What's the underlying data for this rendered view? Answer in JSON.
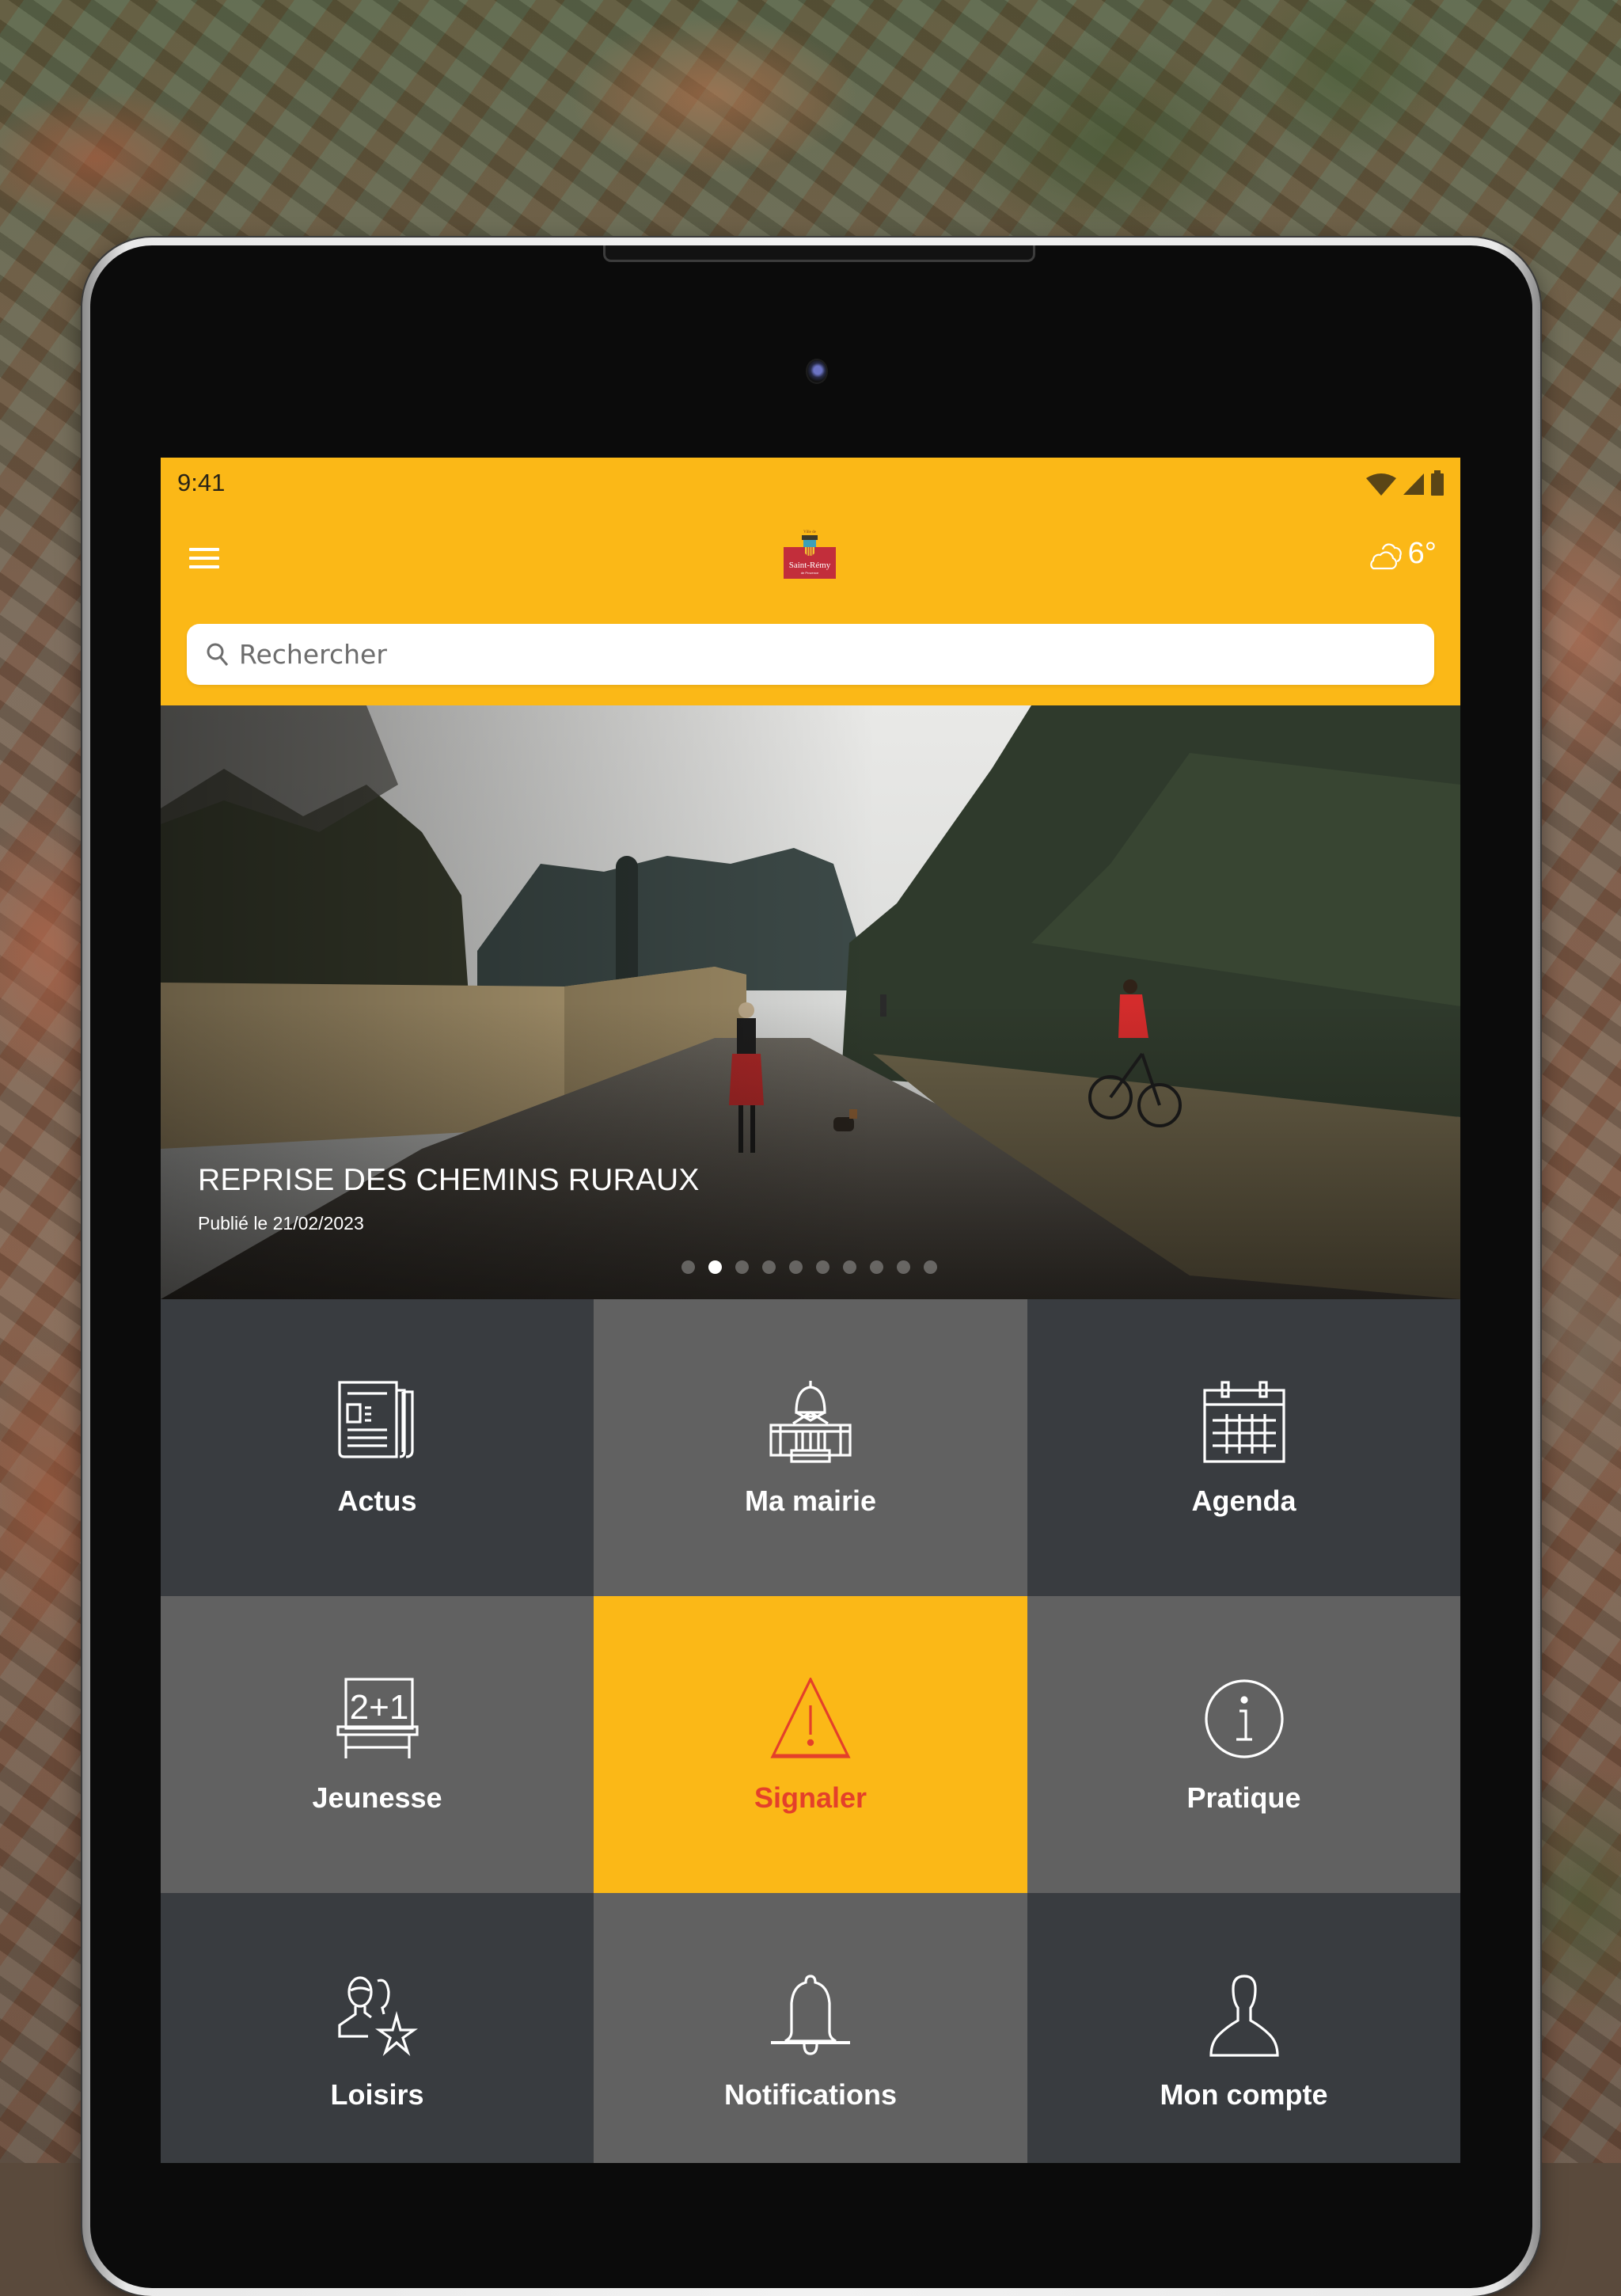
{
  "status_bar": {
    "time": "9:41",
    "icons": [
      "wifi-icon",
      "signal-icon",
      "battery-icon"
    ]
  },
  "app_bar": {
    "menu_icon": "hamburger-menu-icon",
    "logo": {
      "top_text": "Ville de",
      "name": "Saint-Rémy",
      "sub_text": "de Provence"
    },
    "weather": {
      "icon": "cloudy-icon",
      "temperature": "6°"
    }
  },
  "search": {
    "icon": "search-icon",
    "placeholder": "Rechercher",
    "value": ""
  },
  "hero": {
    "title": "REPRISE DES CHEMINS RURAUX",
    "date": "Publié le 21/02/2023",
    "slide_count": 10,
    "active_slide": 2
  },
  "tiles": [
    {
      "label": "Actus",
      "icon": "newspaper-icon"
    },
    {
      "label": "Ma mairie",
      "icon": "town-hall-icon"
    },
    {
      "label": "Agenda",
      "icon": "calendar-icon"
    },
    {
      "label": "Jeunesse",
      "icon": "chalkboard-icon"
    },
    {
      "label": "Signaler",
      "icon": "warning-icon"
    },
    {
      "label": "Pratique",
      "icon": "info-icon"
    },
    {
      "label": "Loisirs",
      "icon": "people-star-icon"
    },
    {
      "label": "Notifications",
      "icon": "bell-icon"
    },
    {
      "label": "Mon compte",
      "icon": "user-icon"
    }
  ],
  "colors": {
    "brand_yellow": "#fbb817",
    "signal_red": "#e4402a",
    "tile_dark": "#393c40",
    "tile_mid": "#616161"
  }
}
